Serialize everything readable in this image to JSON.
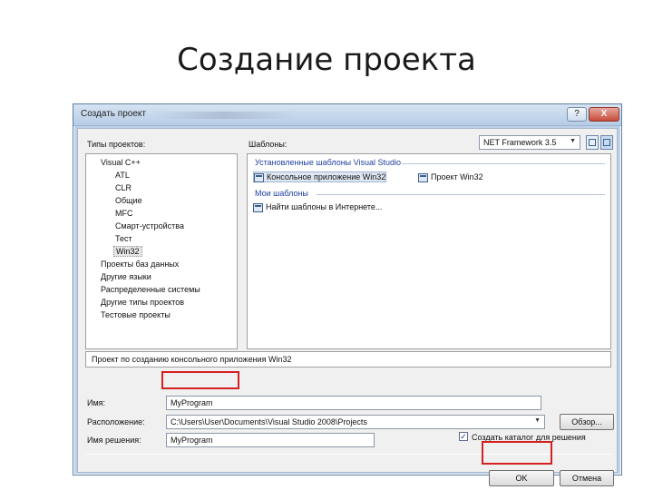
{
  "slide": {
    "title": "Создание проекта"
  },
  "dialog": {
    "title": "Создать проект",
    "help_label": "?",
    "close_label": "X",
    "framework": "NET Framework 3.5",
    "project_types_label": "Типы проектов:",
    "templates_label": "Шаблоны:",
    "tree": [
      {
        "label": "Visual C++",
        "level": 0
      },
      {
        "label": "ATL",
        "level": 1
      },
      {
        "label": "CLR",
        "level": 1
      },
      {
        "label": "Общие",
        "level": 1
      },
      {
        "label": "MFC",
        "level": 1
      },
      {
        "label": "Смарт-устройства",
        "level": 1
      },
      {
        "label": "Тест",
        "level": 1
      },
      {
        "label": "Win32",
        "level": 1,
        "selected": true
      },
      {
        "label": "Проекты баз данных",
        "level": 0
      },
      {
        "label": "Другие языки",
        "level": 0
      },
      {
        "label": "Распределенные системы",
        "level": 0
      },
      {
        "label": "Другие типы проектов",
        "level": 0
      },
      {
        "label": "Тестовые проекты",
        "level": 0
      }
    ],
    "templates": {
      "installed_header": "Установленные шаблоны Visual Studio",
      "installed": [
        {
          "label": "Консольное приложение Win32",
          "selected": true
        },
        {
          "label": "Проект Win32",
          "selected": false
        }
      ],
      "my_header": "Мои шаблоны",
      "my": [
        {
          "label": "Найти шаблоны в Интернете..."
        }
      ]
    },
    "description": "Проект по созданию консольного приложения Win32",
    "name_label": "Имя:",
    "name_value": "MyProgram",
    "location_label": "Расположение:",
    "location_value": "C:\\Users\\User\\Documents\\Visual Studio 2008\\Projects",
    "browse_label": "Обзор...",
    "solution_label": "Имя решения:",
    "solution_value": "MyProgram",
    "create_dir_label": "Создать каталог для решения",
    "create_dir_checked": "✓",
    "ok_label": "OK",
    "cancel_label": "Отмена"
  }
}
